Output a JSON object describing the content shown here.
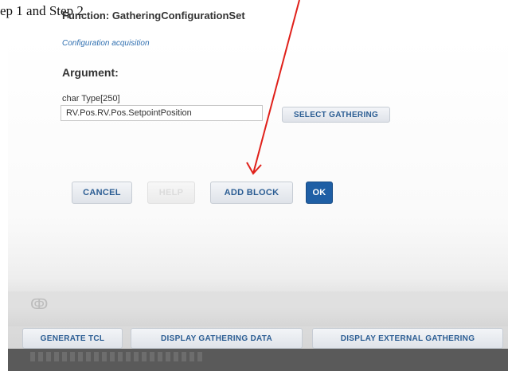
{
  "doc_text": "ep 1 and Step 2.",
  "function": {
    "title": "Function: GatheringConfigurationSet",
    "description": "Configuration acquisition"
  },
  "argument": {
    "heading": "Argument:",
    "type_label": "char Type[250]",
    "value": "RV.Pos.RV.Pos.SetpointPosition"
  },
  "buttons": {
    "select_gathering": "SELECT GATHERING",
    "cancel": "CANCEL",
    "help": "HELP",
    "add_block": "ADD BLOCK",
    "ok": "OK"
  },
  "footer_buttons": {
    "generate_tcl": "GENERATE TCL",
    "display_gathering_data": "DISPLAY GATHERING DATA",
    "display_external_gathering": "DISPLAY EXTERNAL GATHERING"
  },
  "colors": {
    "accent": "#1f5fa5",
    "link": "#2f6fb0",
    "annotation_arrow": "#e0201a"
  },
  "icons": {
    "annotation": "arrow-down-icon"
  }
}
